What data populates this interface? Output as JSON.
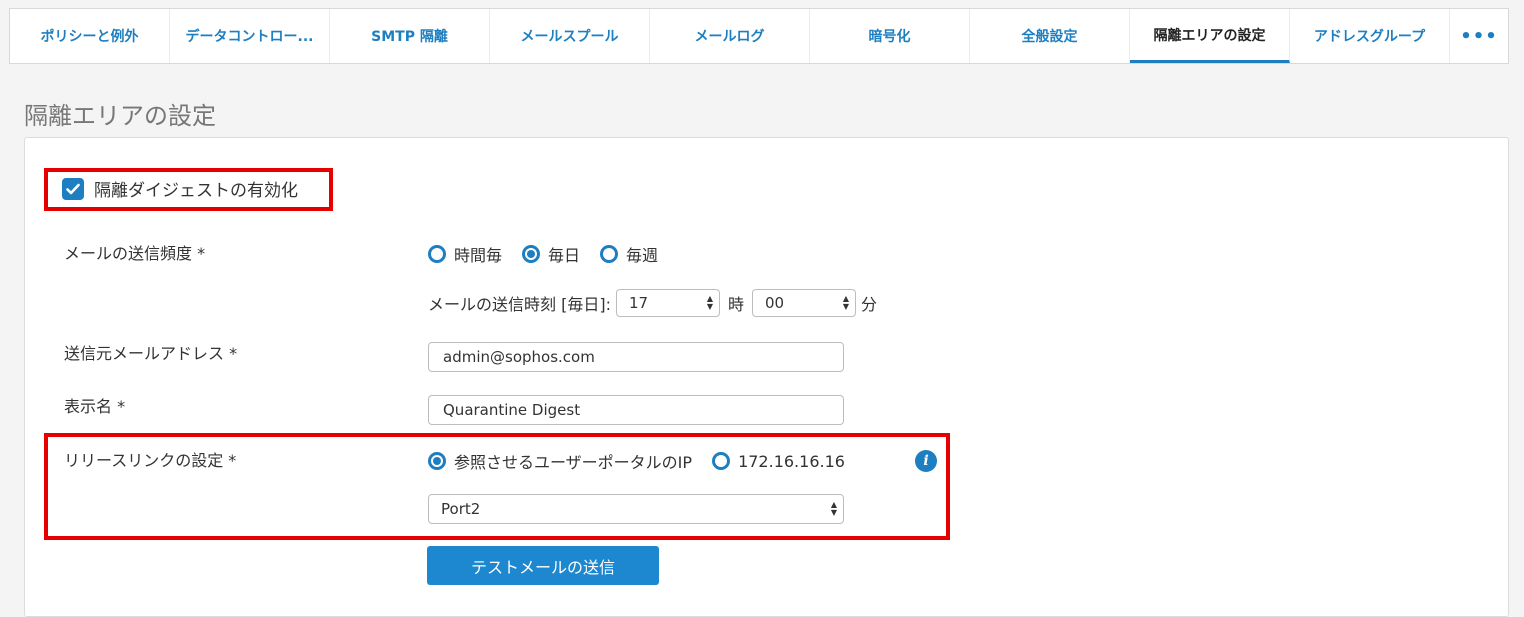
{
  "tabs": [
    {
      "label": "ポリシーと例外"
    },
    {
      "label": "データコントロー..."
    },
    {
      "label": "SMTP 隔離"
    },
    {
      "label": "メールスプール"
    },
    {
      "label": "メールログ"
    },
    {
      "label": "暗号化"
    },
    {
      "label": "全般設定"
    },
    {
      "label": "隔離エリアの設定",
      "active": true
    },
    {
      "label": "アドレスグループ"
    },
    {
      "label": "•••"
    }
  ],
  "page_title": "隔離エリアの設定",
  "digest": {
    "checkbox_label": "隔離ダイジェストの有効化",
    "checked": true
  },
  "frequency": {
    "label": "メールの送信頻度 *",
    "options": [
      "時間毎",
      "毎日",
      "毎週"
    ],
    "selected": "毎日",
    "time_label": "メールの送信時刻 [毎日]:",
    "hour_value": "17",
    "hour_unit": "時",
    "minute_value": "00",
    "minute_unit": "分"
  },
  "sender": {
    "label": "送信元メールアドレス *",
    "value": "admin@sophos.com"
  },
  "display_name": {
    "label": "表示名 *",
    "value": "Quarantine Digest"
  },
  "release_link": {
    "label": "リリースリンクの設定 *",
    "options": [
      "参照させるユーザーポータルのIP",
      "172.16.16.16"
    ],
    "selected": "参照させるユーザーポータルのIP",
    "info_icon": "i",
    "port_value": "Port2"
  },
  "test_button_label": "テストメールの送信",
  "colors": {
    "accent": "#1d7fc1",
    "highlight": "#e60000",
    "button": "#1d87d0"
  }
}
